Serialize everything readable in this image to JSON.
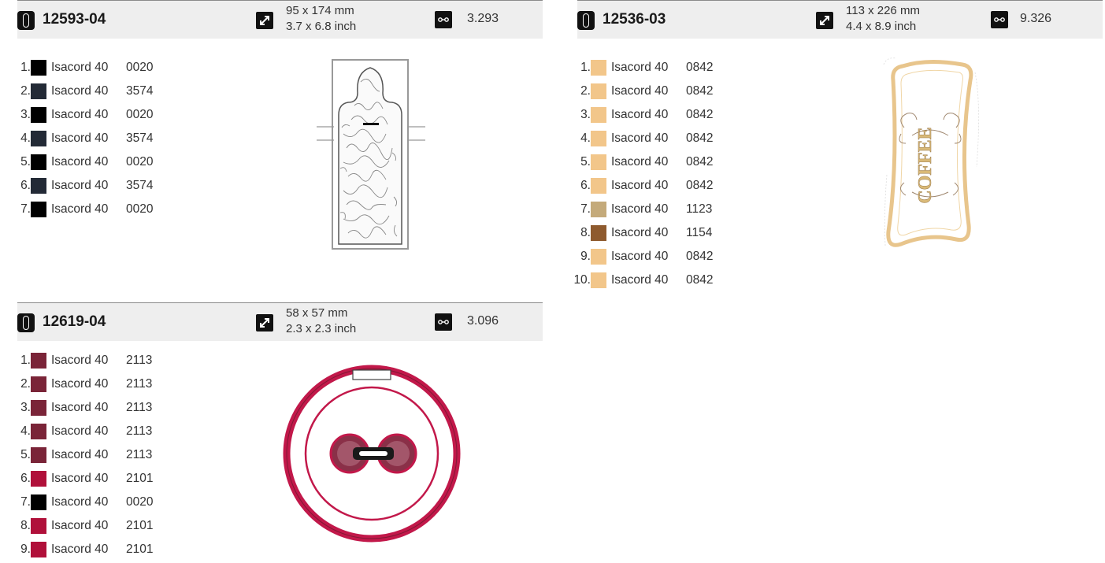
{
  "designs": [
    {
      "id": "12593-04",
      "size_mm": "95 x 174 mm",
      "size_inch": "3.7 x 6.8 inch",
      "stitches": "3.293",
      "threads": [
        {
          "n": "1.",
          "brand": "Isacord 40",
          "code": "0020",
          "color": "#000000"
        },
        {
          "n": "2.",
          "brand": "Isacord 40",
          "code": "3574",
          "color": "#232a36"
        },
        {
          "n": "3.",
          "brand": "Isacord 40",
          "code": "0020",
          "color": "#000000"
        },
        {
          "n": "4.",
          "brand": "Isacord 40",
          "code": "3574",
          "color": "#232a36"
        },
        {
          "n": "5.",
          "brand": "Isacord 40",
          "code": "0020",
          "color": "#000000"
        },
        {
          "n": "6.",
          "brand": "Isacord 40",
          "code": "3574",
          "color": "#232a36"
        },
        {
          "n": "7.",
          "brand": "Isacord 40",
          "code": "0020",
          "color": "#000000"
        }
      ]
    },
    {
      "id": "12536-03",
      "size_mm": "113 x 226 mm",
      "size_inch": "4.4 x 8.9 inch",
      "stitches": "9.326",
      "threads": [
        {
          "n": "1.",
          "brand": "Isacord 40",
          "code": "0842",
          "color": "#f2c68a"
        },
        {
          "n": "2.",
          "brand": "Isacord 40",
          "code": "0842",
          "color": "#f2c68a"
        },
        {
          "n": "3.",
          "brand": "Isacord 40",
          "code": "0842",
          "color": "#f2c68a"
        },
        {
          "n": "4.",
          "brand": "Isacord 40",
          "code": "0842",
          "color": "#f2c68a"
        },
        {
          "n": "5.",
          "brand": "Isacord 40",
          "code": "0842",
          "color": "#f2c68a"
        },
        {
          "n": "6.",
          "brand": "Isacord 40",
          "code": "0842",
          "color": "#f2c68a"
        },
        {
          "n": "7.",
          "brand": "Isacord 40",
          "code": "1123",
          "color": "#c4aa7a"
        },
        {
          "n": "8.",
          "brand": "Isacord 40",
          "code": "1154",
          "color": "#8e5a2e"
        },
        {
          "n": "9.",
          "brand": "Isacord 40",
          "code": "0842",
          "color": "#f2c68a"
        },
        {
          "n": "10.",
          "brand": "Isacord 40",
          "code": "0842",
          "color": "#f2c68a"
        }
      ],
      "artwork_text": "COFFEE"
    },
    {
      "id": "12619-04",
      "size_mm": "58 x 57 mm",
      "size_inch": "2.3 x 2.3 inch",
      "stitches": "3.096",
      "threads": [
        {
          "n": "1.",
          "brand": "Isacord 40",
          "code": "2113",
          "color": "#7a2438"
        },
        {
          "n": "2.",
          "brand": "Isacord 40",
          "code": "2113",
          "color": "#7a2438"
        },
        {
          "n": "3.",
          "brand": "Isacord 40",
          "code": "2113",
          "color": "#7a2438"
        },
        {
          "n": "4.",
          "brand": "Isacord 40",
          "code": "2113",
          "color": "#7a2438"
        },
        {
          "n": "5.",
          "brand": "Isacord 40",
          "code": "2113",
          "color": "#7a2438"
        },
        {
          "n": "6.",
          "brand": "Isacord 40",
          "code": "2101",
          "color": "#b0103a"
        },
        {
          "n": "7.",
          "brand": "Isacord 40",
          "code": "0020",
          "color": "#000000"
        },
        {
          "n": "8.",
          "brand": "Isacord 40",
          "code": "2101",
          "color": "#b0103a"
        },
        {
          "n": "9.",
          "brand": "Isacord 40",
          "code": "2101",
          "color": "#b0103a"
        }
      ]
    }
  ],
  "icons": {
    "hoop": "hoop-icon",
    "size": "resize-arrows-icon",
    "stitches": "stitch-count-icon"
  }
}
